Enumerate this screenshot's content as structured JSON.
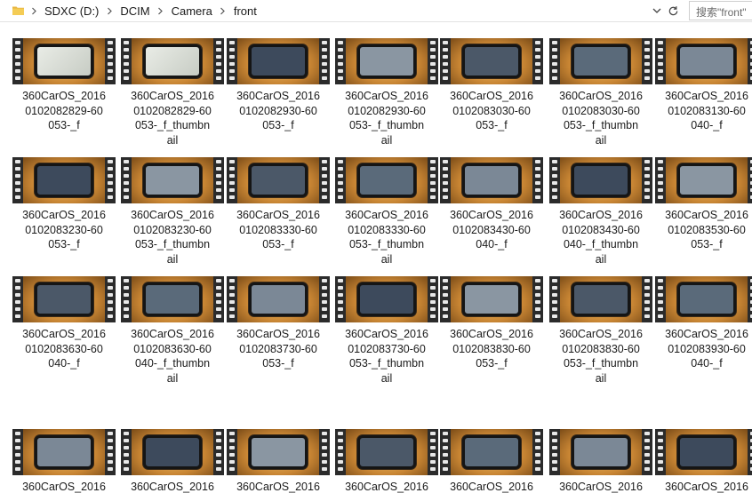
{
  "address_bar": {
    "breadcrumbs": [
      "SDXC (D:)",
      "DCIM",
      "Camera",
      "front"
    ],
    "search_placeholder": "搜索\"front\""
  },
  "files": [
    {
      "line1": "360CarOS_2016",
      "line2": "0102082829-60",
      "line3": "053-_f",
      "line4": ""
    },
    {
      "line1": "360CarOS_2016",
      "line2": "0102082829-60",
      "line3": "053-_f_thumbn",
      "line4": "ail"
    },
    {
      "line1": "360CarOS_2016",
      "line2": "0102082930-60",
      "line3": "053-_f",
      "line4": ""
    },
    {
      "line1": "360CarOS_2016",
      "line2": "0102082930-60",
      "line3": "053-_f_thumbn",
      "line4": "ail"
    },
    {
      "line1": "360CarOS_2016",
      "line2": "0102083030-60",
      "line3": "053-_f",
      "line4": ""
    },
    {
      "line1": "360CarOS_2016",
      "line2": "0102083030-60",
      "line3": "053-_f_thumbn",
      "line4": "ail"
    },
    {
      "line1": "360CarOS_2016",
      "line2": "0102083130-60",
      "line3": "040-_f",
      "line4": ""
    },
    {
      "line1": "360CarOS_2016",
      "line2": "0102083230-60",
      "line3": "053-_f",
      "line4": ""
    },
    {
      "line1": "360CarOS_2016",
      "line2": "0102083230-60",
      "line3": "053-_f_thumbn",
      "line4": "ail"
    },
    {
      "line1": "360CarOS_2016",
      "line2": "0102083330-60",
      "line3": "053-_f",
      "line4": ""
    },
    {
      "line1": "360CarOS_2016",
      "line2": "0102083330-60",
      "line3": "053-_f_thumbn",
      "line4": "ail"
    },
    {
      "line1": "360CarOS_2016",
      "line2": "0102083430-60",
      "line3": "040-_f",
      "line4": ""
    },
    {
      "line1": "360CarOS_2016",
      "line2": "0102083430-60",
      "line3": "040-_f_thumbn",
      "line4": "ail"
    },
    {
      "line1": "360CarOS_2016",
      "line2": "0102083530-60",
      "line3": "053-_f",
      "line4": ""
    },
    {
      "line1": "360CarOS_2016",
      "line2": "0102083630-60",
      "line3": "040-_f",
      "line4": ""
    },
    {
      "line1": "360CarOS_2016",
      "line2": "0102083630-60",
      "line3": "040-_f_thumbn",
      "line4": "ail"
    },
    {
      "line1": "360CarOS_2016",
      "line2": "0102083730-60",
      "line3": "053-_f",
      "line4": ""
    },
    {
      "line1": "360CarOS_2016",
      "line2": "0102083730-60",
      "line3": "053-_f_thumbn",
      "line4": "ail"
    },
    {
      "line1": "360CarOS_2016",
      "line2": "0102083830-60",
      "line3": "053-_f",
      "line4": ""
    },
    {
      "line1": "360CarOS_2016",
      "line2": "0102083830-60",
      "line3": "053-_f_thumbn",
      "line4": "ail"
    },
    {
      "line1": "360CarOS_2016",
      "line2": "0102083930-60",
      "line3": "040-_f",
      "line4": ""
    },
    {
      "line1": "360CarOS_2016",
      "line2": "",
      "line3": "",
      "line4": ""
    },
    {
      "line1": "360CarOS_2016",
      "line2": "",
      "line3": "",
      "line4": ""
    },
    {
      "line1": "360CarOS_2016",
      "line2": "",
      "line3": "",
      "line4": ""
    },
    {
      "line1": "360CarOS_2016",
      "line2": "",
      "line3": "",
      "line4": ""
    },
    {
      "line1": "360CarOS_2016",
      "line2": "",
      "line3": "",
      "line4": ""
    },
    {
      "line1": "360CarOS_2016",
      "line2": "",
      "line3": "",
      "line4": ""
    },
    {
      "line1": "360CarOS_2016",
      "line2": "",
      "line3": "",
      "line4": ""
    }
  ],
  "icons": {
    "folder": "folder-icon",
    "separator": "chevron-right-icon",
    "dropdown": "chevron-down-icon",
    "refresh": "refresh-icon",
    "video": "video-file-icon"
  },
  "colors": {
    "thumb_gold": "#c98634",
    "film_strip": "#2b2b2b",
    "search_border": "#cfcfcf"
  }
}
